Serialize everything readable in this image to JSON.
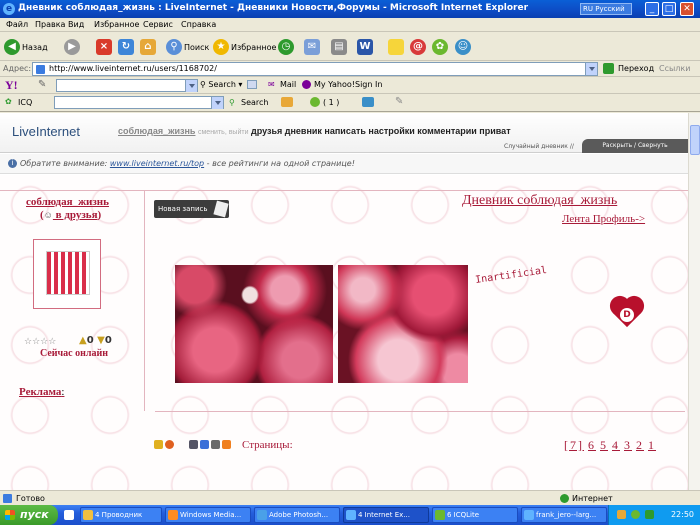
{
  "window": {
    "title": "Дневник соблюдая_жизнь : LiveInternet - Дневники Новости,Форумы - Microsoft Internet Explorer",
    "language": "Русский",
    "lang_code": "RU"
  },
  "menu": [
    "Файл",
    "Правка",
    "Вид",
    "Избранное",
    "Сервис",
    "Справка"
  ],
  "toolbar": {
    "back": "Назад",
    "search": "Поиск",
    "favorites": "Избранное"
  },
  "address": {
    "label": "Адрес:",
    "url": "http://www.liveinternet.ru/users/1168702/",
    "go": "Переход",
    "links": "Ссылки"
  },
  "yahoo_bar": {
    "logo": "Y!",
    "search": "Search",
    "mail": "Mail",
    "my_yahoo": "My Yahoo!",
    "sign_in": "Sign In"
  },
  "icq_bar": {
    "logo": "ICQ",
    "search": "Search",
    "counter": "( 1 )"
  },
  "site": {
    "logo_live": "Live",
    "logo_internet": "Internet",
    "user": "соблюдая_жизнь",
    "change_exit": "сменить, выйти",
    "nav": "друзья дневник написать настройки комментарии приват",
    "random_diary": "Случайный дневник //",
    "expand_collapse": "Раскрыть / Свернуть",
    "notice_prefix": "Обратите внимание:",
    "notice_link": "www.liveinternet.ru/top",
    "notice_suffix": " - все рейтинги на одной странице!"
  },
  "diary": {
    "nick": "соблюдая_жизнь",
    "add_friends_paren_open": "(",
    "add_friends": " в друзья",
    "add_friends_paren_close": ")",
    "new_post": "Новая запись",
    "title": "Дневник соблюдая_жизнь",
    "links": "Лента Профиль->",
    "votes_up": "0",
    "votes_down": "0",
    "online": "Сейчас онлайн",
    "ads": "Реклама",
    "ads_colon": ":",
    "watermark": "Inartificial",
    "heart_letter": "D",
    "pages_label": "Страницы:",
    "pages": [
      "[7]",
      "6",
      "5",
      "4",
      "3",
      "2",
      "1"
    ]
  },
  "status": {
    "done": "Готово",
    "zone": "Интернет"
  },
  "taskbar": {
    "start": "пуск",
    "tasks": [
      "4 Проводник",
      "Windows Media...",
      "Adobe Photosh...",
      "4 Internet Ex...",
      "6 ICQLite",
      "frank_jero--larg..."
    ],
    "clock": "22:50"
  },
  "colors": {
    "accent": "#a81b39",
    "xp_blue": "#245edb"
  }
}
